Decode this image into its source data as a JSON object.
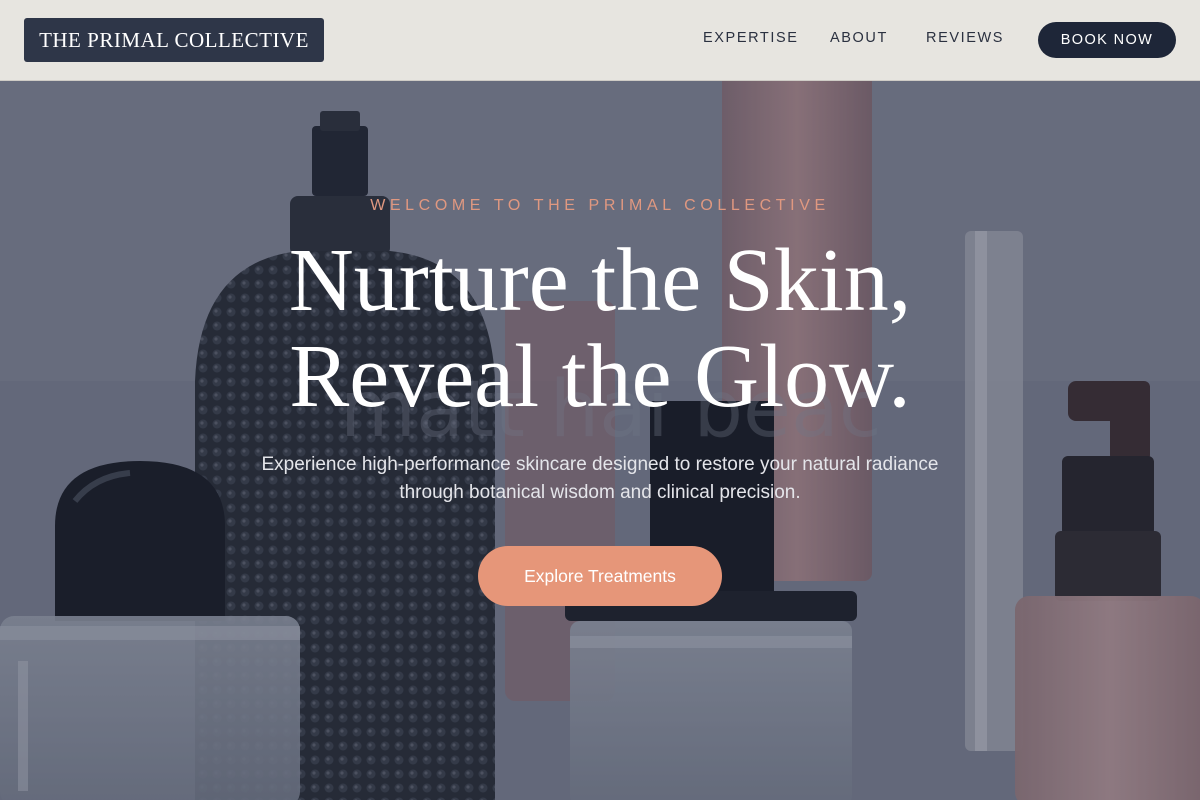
{
  "header": {
    "logo": "THE PRIMAL COLLECTIVE",
    "nav": [
      {
        "label": "EXPERTISE"
      },
      {
        "label": "ABOUT"
      },
      {
        "label": "REVIEWS"
      }
    ],
    "book_button": "BOOK NOW"
  },
  "hero": {
    "eyebrow": "WELCOME TO THE PRIMAL COLLECTIVE",
    "headline_line1": "Nurture the Skin,",
    "headline_line2": "Reveal the Glow.",
    "subtext": "Experience high-performance skincare designed to restore your natural radiance through botanical wisdom and clinical precision.",
    "cta": "Explore Treatments"
  },
  "colors": {
    "header_bg": "#e7e5e0",
    "logo_bg": "#2e3648",
    "book_button_bg": "#1e2638",
    "accent": "#e69679",
    "eyebrow": "#e09880"
  }
}
